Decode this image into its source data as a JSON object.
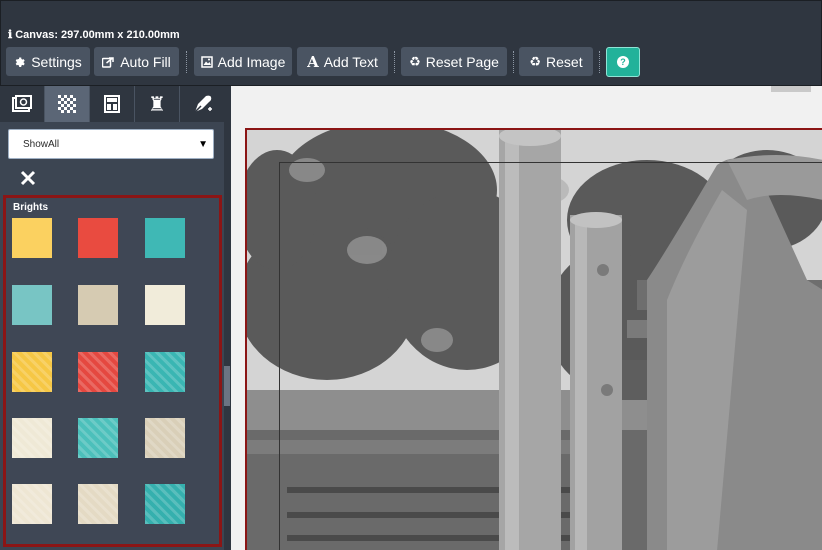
{
  "canvas_info": {
    "icon": "info-icon",
    "text": "Canvas: 297.00mm x 210.00mm"
  },
  "toolbar": {
    "settings": {
      "label": "Settings",
      "icon": "gear-icon"
    },
    "auto_fill": {
      "label": "Auto Fill",
      "icon": "share-icon"
    },
    "add_image": {
      "label": "Add Image",
      "icon": "image-icon"
    },
    "add_text": {
      "label": "Add Text",
      "icon": "text-icon"
    },
    "reset_page": {
      "label": "Reset Page",
      "icon": "recycle-icon"
    },
    "reset": {
      "label": "Reset",
      "icon": "recycle-icon"
    },
    "help": {
      "label": "?",
      "icon": "question-icon",
      "color": "#22b29a"
    }
  },
  "panel": {
    "tabs": [
      {
        "icon": "photos-icon",
        "active": false
      },
      {
        "icon": "checkerboard-icon",
        "active": true
      },
      {
        "icon": "layout-icon",
        "active": false
      },
      {
        "icon": "rook-icon",
        "active": false
      },
      {
        "icon": "pen-icon",
        "active": false
      }
    ],
    "filter": {
      "value": "ShowAll"
    },
    "close_icon": "close-icon",
    "section_title": "Brights",
    "swatches": [
      {
        "name": "yellow",
        "color": "#fbd160"
      },
      {
        "name": "red",
        "color": "#e94b40"
      },
      {
        "name": "teal",
        "color": "#3fb8b5"
      },
      {
        "name": "light-teal",
        "color": "#78c5c4"
      },
      {
        "name": "beige",
        "color": "#d6cbb2"
      },
      {
        "name": "cream",
        "color": "#f1ecda"
      },
      {
        "name": "yellow-pattern",
        "color": "#f6c744"
      },
      {
        "name": "red-pattern",
        "color": "#e54840"
      },
      {
        "name": "teal-pattern",
        "color": "#3ab6b3"
      },
      {
        "name": "cream-illustration",
        "color": "#efe9d6"
      },
      {
        "name": "teal-texture",
        "color": "#4cc0bb"
      },
      {
        "name": "beige-pattern",
        "color": "#d9cfb8"
      },
      {
        "name": "cream-stripes",
        "color": "#eee6d3"
      },
      {
        "name": "beige-feathers",
        "color": "#e4dac4"
      },
      {
        "name": "teal-dots",
        "color": "#35b0ae"
      }
    ]
  },
  "colors": {
    "toolbar_bg": "#2f3640",
    "button_bg": "#4a5462",
    "accent": "#22b29a",
    "selection_border": "#8b1515"
  }
}
